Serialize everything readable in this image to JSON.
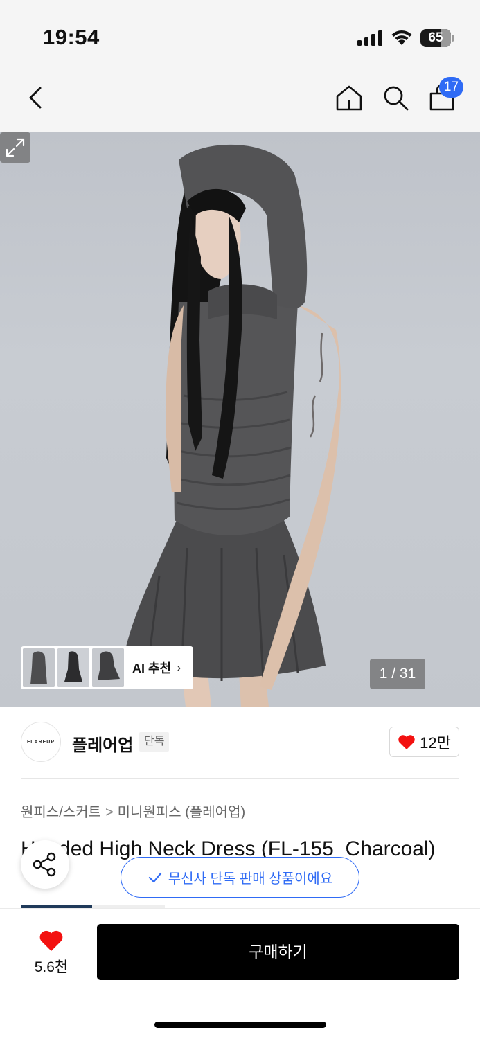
{
  "status_bar": {
    "time": "19:54",
    "battery": "65",
    "battery_level": 0.65
  },
  "nav": {
    "cart_count": "17",
    "accent_color": "#2f6bf5"
  },
  "gallery": {
    "ai_label": "AI 추천",
    "page_counter": "1 / 31"
  },
  "brand": {
    "logo_text": "FLAREUP",
    "name": "플레어업",
    "tag": "단독",
    "likes": "12만"
  },
  "breadcrumb": {
    "category": "원피스/스커트",
    "separator": ">",
    "subcategory": "미니원피스 (플레어업)"
  },
  "product": {
    "title": "Hooded High Neck Dress (FL-155_Charcoal)"
  },
  "toast": {
    "text": "무신사 단독 판매 상품이에요"
  },
  "action_bar": {
    "wish_count": "5.6천",
    "buy_label": "구매하기",
    "heart_color": "#f31110"
  }
}
